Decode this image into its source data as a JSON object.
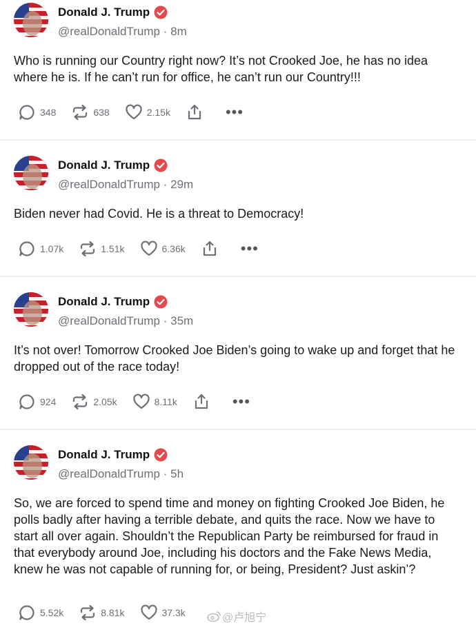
{
  "posts": [
    {
      "author": "Donald J. Trump",
      "handle": "@realDonaldTrump",
      "sep": "·",
      "time": "8m",
      "text": "Who is running our Country right now? It’s not Crooked Joe, he has no idea where he is. If he can’t run for office, he can’t run our Country!!!",
      "replies": "348",
      "retruths": "638",
      "likes": "2.15k"
    },
    {
      "author": "Donald J. Trump",
      "handle": "@realDonaldTrump",
      "sep": "·",
      "time": "29m",
      "text": "Biden never had Covid. He is a threat to Democracy!",
      "replies": "1.07k",
      "retruths": "1.51k",
      "likes": "6.36k"
    },
    {
      "author": "Donald J. Trump",
      "handle": "@realDonaldTrump",
      "sep": "·",
      "time": "35m",
      "text": "It’s not over! Tomorrow Crooked Joe Biden’s going to wake up and forget that he dropped out of the race today!",
      "replies": "924",
      "retruths": "2.05k",
      "likes": "8.11k"
    },
    {
      "author": "Donald J. Trump",
      "handle": "@realDonaldTrump",
      "sep": "·",
      "time": "5h",
      "text": "So, we are forced to spend time and money on fighting Crooked Joe Biden, he polls badly after having a terrible debate, and quits the race. Now we have to start all over again. Shouldn’t the Republican Party be reimbursed for fraud in that everybody around Joe, including his doctors and the Fake News Media, knew he was not capable of running for, or being, President? Just askin’?",
      "replies": "5.52k",
      "retruths": "8.81k",
      "likes": "37.3k"
    }
  ],
  "more_glyph": "•••",
  "watermark": "@卢旭宁",
  "colors": {
    "verified": "#e5484d",
    "icon": "#6b6f76",
    "accent": "#c8202a"
  },
  "icons": [
    "avatar",
    "verified-badge-icon",
    "reply-icon",
    "retruth-icon",
    "heart-icon",
    "share-icon",
    "more-icon",
    "weibo-icon"
  ]
}
